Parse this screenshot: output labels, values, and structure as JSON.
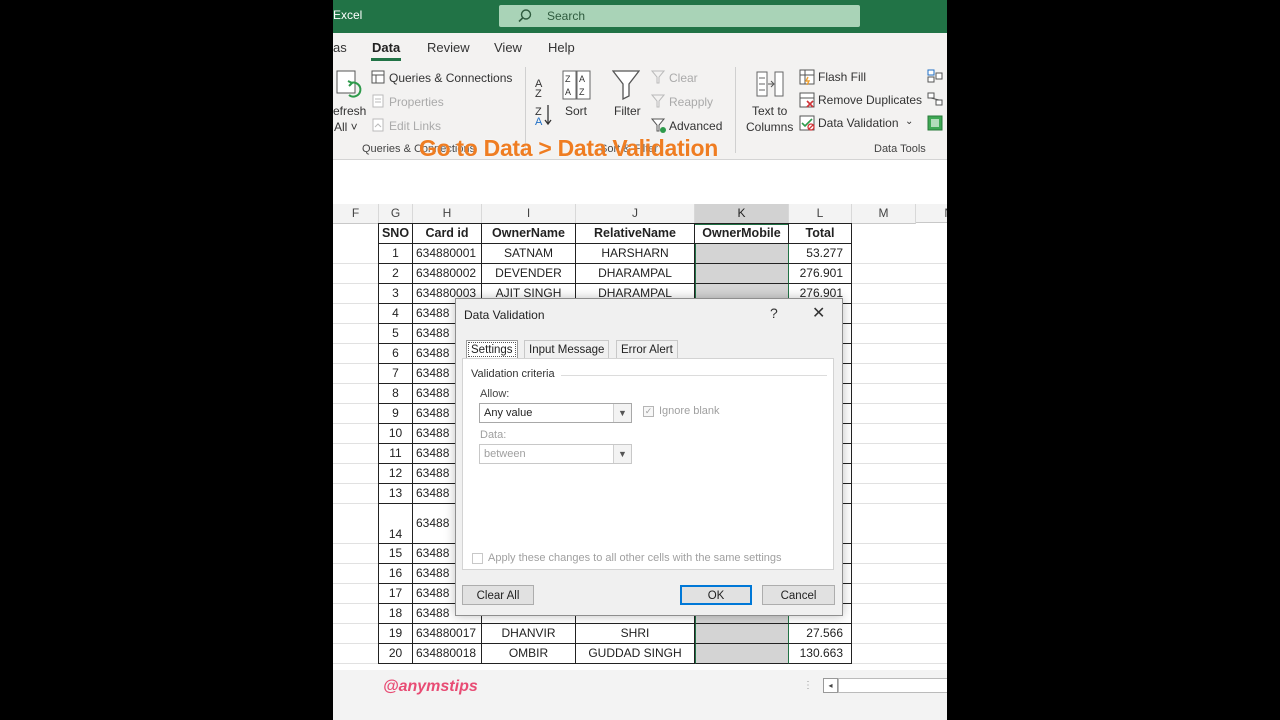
{
  "app": {
    "title": "Excel"
  },
  "search": {
    "placeholder": "Search"
  },
  "ribbon_tabs": [
    {
      "label": "as"
    },
    {
      "label": "Data"
    },
    {
      "label": "Review"
    },
    {
      "label": "View"
    },
    {
      "label": "Help"
    }
  ],
  "ribbon": {
    "refresh_line1": "efresh",
    "refresh_line2": "All ˅",
    "queries_connections": "Queries & Connections",
    "properties": "Properties",
    "edit_links": "Edit Links",
    "group_queries": "Queries & Connections",
    "sort": "Sort",
    "filter": "Filter",
    "clear": "Clear",
    "reapply": "Reapply",
    "advanced": "Advanced",
    "group_sort_filter": "Sort & Filter",
    "text_to_line1": "Text to",
    "text_to_line2": "Columns",
    "flash_fill": "Flash Fill",
    "remove_duplicates": "Remove Duplicates",
    "data_validation": "Data Validation",
    "group_data_tools": "Data Tools"
  },
  "overlay": {
    "caption": "Go to Data > Data Validation",
    "handle": "@anymstips"
  },
  "colors": {
    "excel_green": "#217346",
    "caption_orange": "#ef7d22",
    "handle_pink": "#e84c74"
  },
  "columns": [
    {
      "letter": "F"
    },
    {
      "letter": "G"
    },
    {
      "letter": "H"
    },
    {
      "letter": "I"
    },
    {
      "letter": "J"
    },
    {
      "letter": "K"
    },
    {
      "letter": "L"
    },
    {
      "letter": "M"
    },
    {
      "letter": "N"
    }
  ],
  "table": {
    "headers": [
      "SNO",
      "Card id",
      "OwnerName",
      "RelativeName",
      "OwnerMobile",
      "Total"
    ],
    "rows": [
      [
        "1",
        "634880001",
        "SATNAM",
        "HARSHARN",
        "",
        "53.277"
      ],
      [
        "2",
        "634880002",
        "DEVENDER",
        "DHARAMPAL",
        "",
        "276.901"
      ],
      [
        "3",
        "634880003",
        "AJIT SINGH",
        "DHARAMPAL",
        "",
        "276.901"
      ],
      [
        "4",
        "63488",
        "",
        "",
        "",
        ""
      ],
      [
        "5",
        "63488",
        "",
        "",
        "",
        ""
      ],
      [
        "6",
        "63488",
        "",
        "",
        "",
        ""
      ],
      [
        "7",
        "63488",
        "",
        "",
        "",
        ""
      ],
      [
        "8",
        "63488",
        "",
        "",
        "",
        ""
      ],
      [
        "9",
        "63488",
        "",
        "",
        "",
        ""
      ],
      [
        "10",
        "63488",
        "",
        "",
        "",
        ""
      ],
      [
        "11",
        "63488",
        "",
        "",
        "",
        ""
      ],
      [
        "12",
        "63488",
        "",
        "",
        "",
        ""
      ],
      [
        "13",
        "63488",
        "",
        "",
        "",
        ""
      ],
      [
        "14",
        "63488",
        "",
        "",
        "",
        ""
      ],
      [
        "15",
        "63488",
        "",
        "",
        "",
        ""
      ],
      [
        "16",
        "63488",
        "",
        "",
        "",
        ""
      ],
      [
        "17",
        "63488",
        "",
        "",
        "",
        ""
      ],
      [
        "18",
        "63488",
        "",
        "",
        "",
        ""
      ],
      [
        "19",
        "634880017",
        "DHANVIR",
        "SHRI",
        "",
        "27.566"
      ],
      [
        "20",
        "634880018",
        "OMBIR",
        "GUDDAD SINGH",
        "",
        "130.663"
      ]
    ]
  },
  "dialog": {
    "title": "Data Validation",
    "help": "?",
    "close": "✕",
    "tabs": [
      {
        "label": "Settings"
      },
      {
        "label": "Input Message"
      },
      {
        "label": "Error Alert"
      }
    ],
    "section": "Validation criteria",
    "allow_label": "Allow:",
    "allow_value": "Any value",
    "ignore_blank": "Ignore blank",
    "data_label": "Data:",
    "data_value": "between",
    "apply_all": "Apply these changes to all other cells with the same settings",
    "clear_all": "Clear All",
    "ok": "OK",
    "cancel": "Cancel"
  }
}
